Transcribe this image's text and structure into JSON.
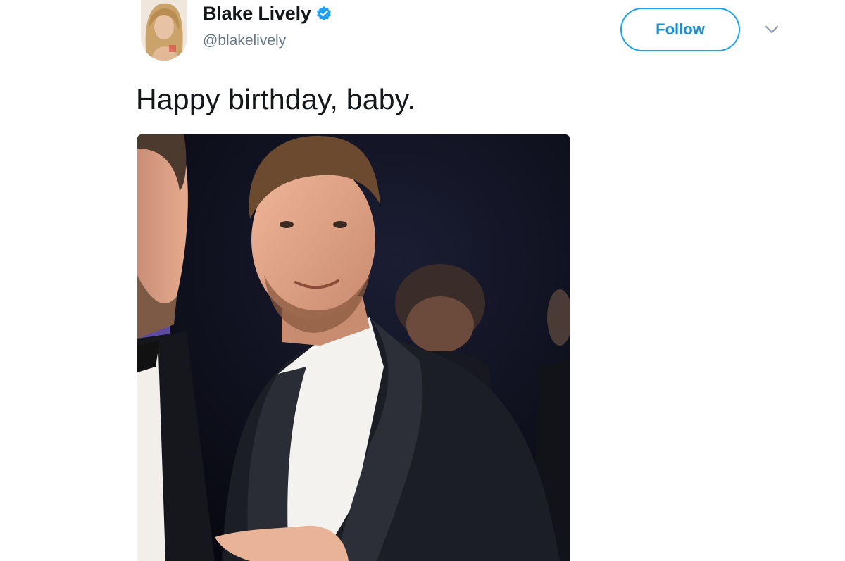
{
  "tweet": {
    "author": {
      "display_name": "Blake Lively",
      "handle": "@blakelively",
      "verified": true,
      "avatar_icon": "avatar-photo-icon"
    },
    "follow_label": "Follow",
    "menu_icon": "chevron-down-icon",
    "text": "Happy birthday, baby.",
    "media": {
      "type": "photo",
      "alt": "Photo of a smiling man in a black tuxedo pointing at himself, another man partially visible at left"
    }
  },
  "colors": {
    "accent": "#1da1f2",
    "verified": "#1da1f2",
    "handle": "#657786",
    "text": "#14171a"
  }
}
